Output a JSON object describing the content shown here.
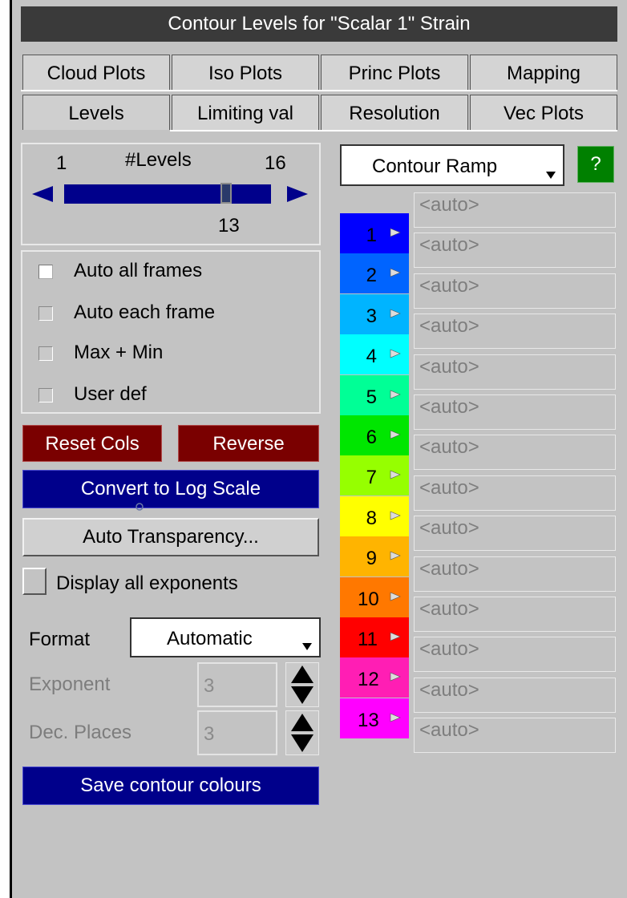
{
  "window": {
    "title": "Contour Levels for \"Scalar 1\" Strain"
  },
  "tabs": {
    "row1": [
      "Cloud Plots",
      "Iso Plots",
      "Princ Plots",
      "Mapping"
    ],
    "row2": [
      "Levels",
      "Limiting val",
      "Resolution",
      "Vec Plots"
    ],
    "active": "Levels"
  },
  "levels_slider": {
    "min_label": "1",
    "title": "#Levels",
    "max_label": "16",
    "value": "13",
    "fraction": 0.8
  },
  "options": {
    "auto_all_frames": "Auto all frames",
    "auto_each_frame": "Auto each frame",
    "max_min": "Max + Min",
    "user_def": "User def"
  },
  "buttons": {
    "reset_cols": "Reset Cols",
    "reverse": "Reverse",
    "convert_log": "Convert to Log Scale",
    "auto_transparency": "Auto Transparency...",
    "save_colours": "Save contour colours",
    "help": "?"
  },
  "display_exponents": {
    "label": "Display all exponents"
  },
  "format": {
    "label": "Format",
    "value": "Automatic"
  },
  "exponent": {
    "label": "Exponent",
    "value": "3"
  },
  "dec_places": {
    "label": "Dec. Places",
    "value": "3"
  },
  "ramp": {
    "selected": "Contour Ramp"
  },
  "contour_levels": [
    {
      "num": "1",
      "color": "#0000ff",
      "text": "#ffffff"
    },
    {
      "num": "2",
      "color": "#0064ff",
      "text": "#ffffff"
    },
    {
      "num": "3",
      "color": "#00b4ff",
      "text": "#000000"
    },
    {
      "num": "4",
      "color": "#00ffff",
      "text": "#000000"
    },
    {
      "num": "5",
      "color": "#00ff96",
      "text": "#000000"
    },
    {
      "num": "6",
      "color": "#00e600",
      "text": "#000000"
    },
    {
      "num": "7",
      "color": "#96ff00",
      "text": "#000000"
    },
    {
      "num": "8",
      "color": "#ffff00",
      "text": "#000000"
    },
    {
      "num": "9",
      "color": "#ffb400",
      "text": "#000000"
    },
    {
      "num": "10",
      "color": "#ff7800",
      "text": "#000000"
    },
    {
      "num": "11",
      "color": "#ff0000",
      "text": "#000000"
    },
    {
      "num": "12",
      "color": "#ff1eb4",
      "text": "#ffffff"
    },
    {
      "num": "13",
      "color": "#ff00ff",
      "text": "#ffffff"
    }
  ],
  "level_values": [
    "<auto>",
    "<auto>",
    "<auto>",
    "<auto>",
    "<auto>",
    "<auto>",
    "<auto>",
    "<auto>",
    "<auto>",
    "<auto>",
    "<auto>",
    "<auto>",
    "<auto>",
    "<auto>"
  ]
}
